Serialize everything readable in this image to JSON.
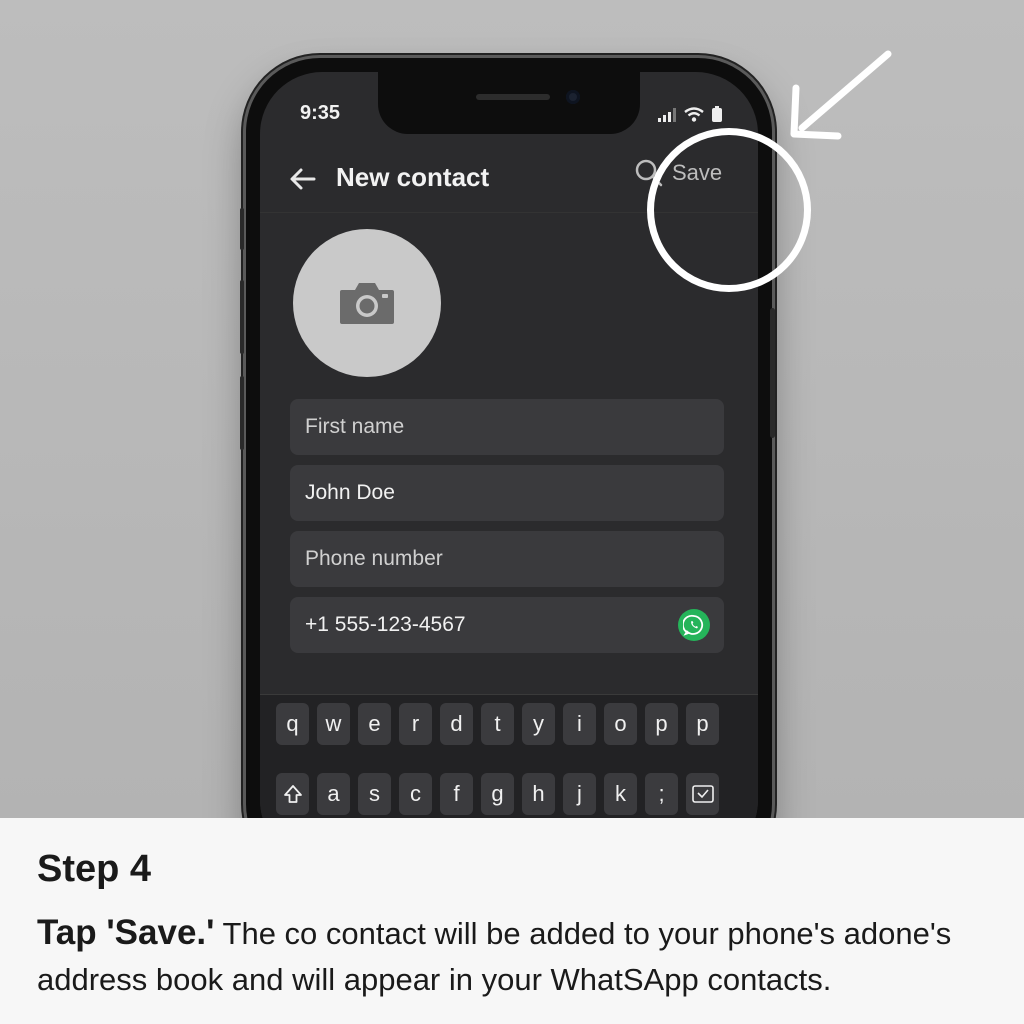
{
  "status_bar": {
    "time": "9:35"
  },
  "app_bar": {
    "title": "New contact",
    "save_label": "Save"
  },
  "form": {
    "first_name_placeholder": "First name",
    "name_value": "John Doe",
    "phone_placeholder": "Phone number",
    "phone_value": "+1 555-123-4567"
  },
  "keyboard": {
    "row1": [
      "q",
      "w",
      "e",
      "r",
      "d",
      "t",
      "y",
      "i",
      "o",
      "p",
      "p"
    ],
    "row2": [
      "a",
      "s",
      "c",
      "f",
      "g",
      "h",
      "j",
      "k",
      ";"
    ]
  },
  "caption": {
    "step": "Step 4",
    "strong": "Tap 'Save.'",
    "body": " The co contact will be added to your phone's adone's address book and will appear in your WhatSApp contacts."
  },
  "colors": {
    "whatsapp_green": "#25b45a",
    "screen_bg": "#2b2b2d",
    "annotation": "#ffffff"
  },
  "icons": [
    "back-arrow-icon",
    "search-icon",
    "camera-icon",
    "whatsapp-icon",
    "shift-icon",
    "emoji-icon",
    "signal-icon",
    "wifi-icon",
    "battery-icon",
    "pointer-arrow"
  ]
}
